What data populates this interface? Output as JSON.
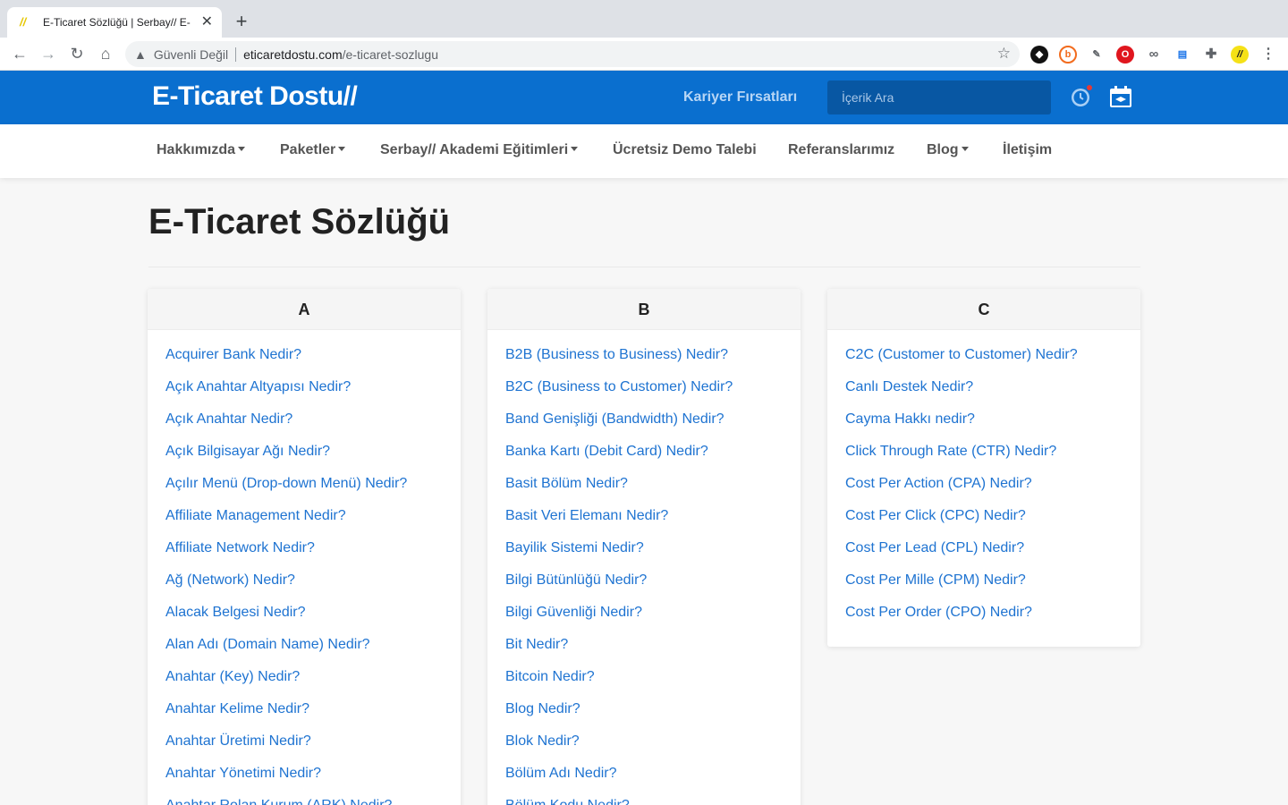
{
  "browser": {
    "tab_title": "E-Ticaret Sözlüğü | Serbay// E-",
    "security_text": "Güvenli Değil",
    "url_domain": "eticaretdostu.com",
    "url_path": "/e-ticaret-sozlugu"
  },
  "header": {
    "logo": "E-Ticaret Dostu//",
    "career_link": "Kariyer Fırsatları",
    "search_placeholder": "İçerik Ara",
    "brand_color": "#0a6fcf"
  },
  "nav": {
    "items": [
      {
        "label": "Hakkımızda"
      },
      {
        "label": "Paketler"
      },
      {
        "label": "Serbay// Akademi Eğitimleri"
      },
      {
        "label": "Ücretsiz Demo Talebi"
      },
      {
        "label": "Referanslarımız"
      },
      {
        "label": "Blog"
      },
      {
        "label": "İletişim"
      }
    ]
  },
  "page": {
    "title": "E-Ticaret Sözlüğü"
  },
  "columns": [
    {
      "letter": "A",
      "items": [
        "Acquirer Bank Nedir?",
        "Açık Anahtar Altyapısı Nedir?",
        "Açık Anahtar Nedir?",
        "Açık Bilgisayar Ağı Nedir?",
        "Açılır Menü (Drop-down Menü) Nedir?",
        "Affiliate Management Nedir?",
        "Affiliate Network Nedir?",
        "Ağ (Network) Nedir?",
        "Alacak Belgesi Nedir?",
        "Alan Adı (Domain Name) Nedir?",
        "Anahtar (Key) Nedir?",
        "Anahtar Kelime Nedir?",
        "Anahtar Üretimi Nedir?",
        "Anahtar Yönetimi Nedir?",
        "Anahtar Rolan Kurum (ARK) Nedir?"
      ]
    },
    {
      "letter": "B",
      "items": [
        "B2B (Business to Business) Nedir?",
        "B2C (Business to Customer) Nedir?",
        "Band Genişliği (Bandwidth) Nedir?",
        "Banka Kartı (Debit Card) Nedir?",
        "Basit Bölüm Nedir?",
        "Basit Veri Elemanı Nedir?",
        "Bayilik Sistemi Nedir?",
        "Bilgi Bütünlüğü Nedir?",
        "Bilgi Güvenliği Nedir?",
        "Bit Nedir?",
        "Bitcoin Nedir?",
        "Blog Nedir?",
        "Blok Nedir?",
        "Bölüm Adı Nedir?",
        "Bölüm Kodu Nedir?"
      ]
    },
    {
      "letter": "C",
      "items": [
        "C2C (Customer to Customer) Nedir?",
        "Canlı Destek Nedir?",
        "Cayma Hakkı nedir?",
        "Click Through Rate (CTR) Nedir?",
        "Cost Per Action (CPA) Nedir?",
        "Cost Per Click (CPC) Nedir?",
        "Cost Per Lead (CPL) Nedir?",
        "Cost Per Mille (CPM) Nedir?",
        "Cost Per Order (CPO) Nedir?"
      ]
    }
  ]
}
